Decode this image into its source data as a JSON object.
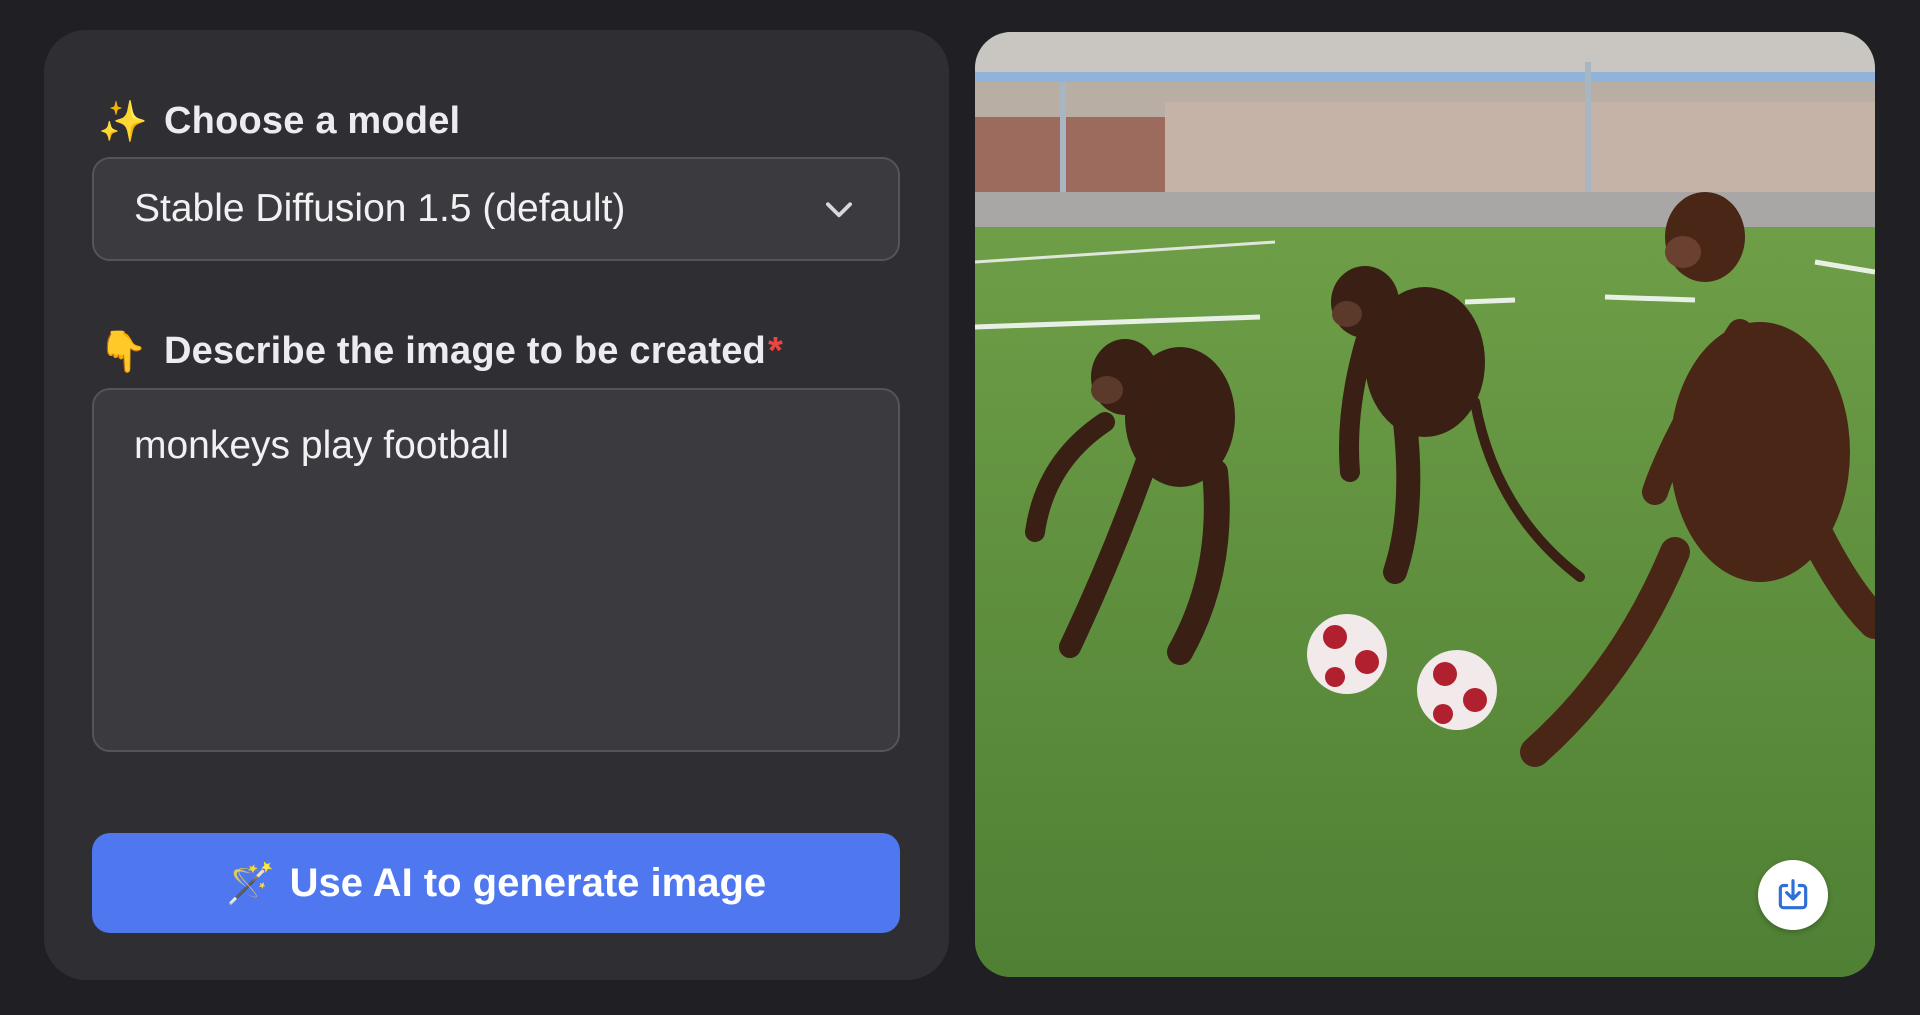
{
  "model_section": {
    "icon": "sparkles-icon",
    "emoji": "✨",
    "label": "Choose a model",
    "selected_model": "Stable Diffusion 1.5 (default)"
  },
  "prompt_section": {
    "icon": "pointing-down-icon",
    "emoji": "👇",
    "label": "Describe the image to be created",
    "required_mark": "*",
    "value": "monkeys play football"
  },
  "generate_button": {
    "icon": "magic-wand-icon",
    "emoji": "🪄",
    "label": "Use AI to generate image"
  },
  "result": {
    "download_icon": "download-icon"
  },
  "colors": {
    "background": "#202024",
    "panel": "#2f2f33",
    "accent": "#4f78f0",
    "required": "#ef4444"
  }
}
